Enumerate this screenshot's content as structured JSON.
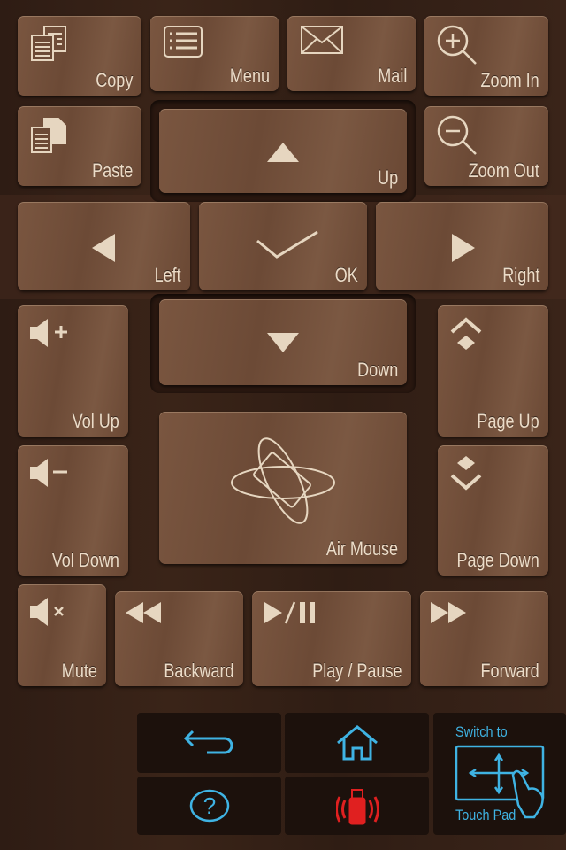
{
  "buttons": {
    "copy": "Copy",
    "menu": "Menu",
    "mail": "Mail",
    "zoom_in": "Zoom In",
    "paste": "Paste",
    "up": "Up",
    "zoom_out": "Zoom Out",
    "left": "Left",
    "ok": "OK",
    "right": "Right",
    "vol_up": "Vol Up",
    "down": "Down",
    "page_up": "Page Up",
    "air_mouse": "Air Mouse",
    "vol_down": "Vol Down",
    "page_down": "Page Down",
    "mute": "Mute",
    "backward": "Backward",
    "play_pause": "Play / Pause",
    "forward": "Forward"
  },
  "bottom": {
    "switch_top": "Switch to",
    "switch_bottom": "Touch Pad",
    "icons": [
      "back-arrow-icon",
      "home-icon",
      "help-icon",
      "usb-signal-icon",
      "touchpad-icon"
    ]
  },
  "colors": {
    "accent": "#3fb3e3",
    "usb": "#e02020",
    "label": "#ecdcc8"
  }
}
